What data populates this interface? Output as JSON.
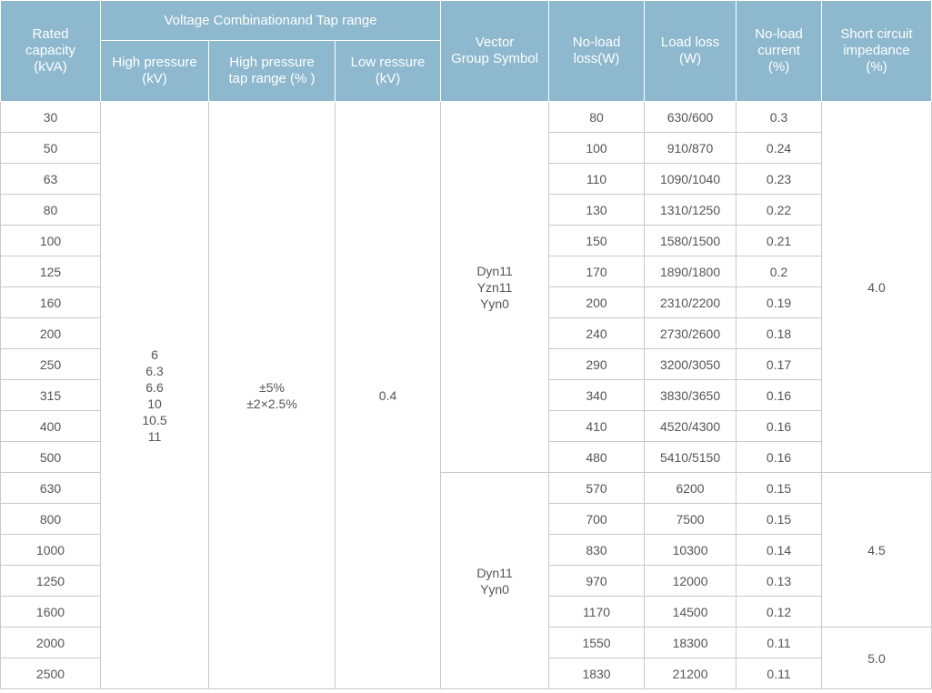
{
  "headers": {
    "rated_capacity": "Rated\ncapacity\n(kVA)",
    "voltage_group": "Voltage Combinationand Tap range",
    "high_pressure": "High pressure\n(kV)",
    "high_pressure_tap": "High pressure\ntap range (% )",
    "low_pressure": "Low ressure\n(kV)",
    "vector_group": "Vector\nGroup Symbol",
    "no_load_loss": "No-load\nloss(W)",
    "load_loss": "Load loss\n(W)",
    "no_load_current": "No-load\ncurrent\n(%)",
    "short_circuit": "Short circuit\nimpedance\n(%)"
  },
  "merged": {
    "high_pressure_values": "6\n6.3\n6.6\n10\n10.5\n11",
    "tap_range": "±5%\n±2×2.5%",
    "low_pressure_value": "0.4",
    "vector_group_a": "Dyn11\nYzn11\nYyn0",
    "vector_group_b": "Dyn11\nYyn0",
    "impedance_a": "4.0",
    "impedance_b": "4.5",
    "impedance_c": "5.0"
  },
  "rows": [
    {
      "capacity": "30",
      "no_load_loss": "80",
      "load_loss": "630/600",
      "no_load_current": "0.3"
    },
    {
      "capacity": "50",
      "no_load_loss": "100",
      "load_loss": "910/870",
      "no_load_current": "0.24"
    },
    {
      "capacity": "63",
      "no_load_loss": "110",
      "load_loss": "1090/1040",
      "no_load_current": "0.23"
    },
    {
      "capacity": "80",
      "no_load_loss": "130",
      "load_loss": "1310/1250",
      "no_load_current": "0.22"
    },
    {
      "capacity": "100",
      "no_load_loss": "150",
      "load_loss": "1580/1500",
      "no_load_current": "0.21"
    },
    {
      "capacity": "125",
      "no_load_loss": "170",
      "load_loss": "1890/1800",
      "no_load_current": "0.2"
    },
    {
      "capacity": "160",
      "no_load_loss": "200",
      "load_loss": "2310/2200",
      "no_load_current": "0.19"
    },
    {
      "capacity": "200",
      "no_load_loss": "240",
      "load_loss": "2730/2600",
      "no_load_current": "0.18"
    },
    {
      "capacity": "250",
      "no_load_loss": "290",
      "load_loss": "3200/3050",
      "no_load_current": "0.17"
    },
    {
      "capacity": "315",
      "no_load_loss": "340",
      "load_loss": "3830/3650",
      "no_load_current": "0.16"
    },
    {
      "capacity": "400",
      "no_load_loss": "410",
      "load_loss": "4520/4300",
      "no_load_current": "0.16"
    },
    {
      "capacity": "500",
      "no_load_loss": "480",
      "load_loss": "5410/5150",
      "no_load_current": "0.16"
    },
    {
      "capacity": "630",
      "no_load_loss": "570",
      "load_loss": "6200",
      "no_load_current": "0.15"
    },
    {
      "capacity": "800",
      "no_load_loss": "700",
      "load_loss": "7500",
      "no_load_current": "0.15"
    },
    {
      "capacity": "1000",
      "no_load_loss": "830",
      "load_loss": "10300",
      "no_load_current": "0.14"
    },
    {
      "capacity": "1250",
      "no_load_loss": "970",
      "load_loss": "12000",
      "no_load_current": "0.13"
    },
    {
      "capacity": "1600",
      "no_load_loss": "1170",
      "load_loss": "14500",
      "no_load_current": "0.12"
    },
    {
      "capacity": "2000",
      "no_load_loss": "1550",
      "load_loss": "18300",
      "no_load_current": "0.11"
    },
    {
      "capacity": "2500",
      "no_load_loss": "1830",
      "load_loss": "21200",
      "no_load_current": "0.11"
    }
  ],
  "colors": {
    "header_bg": "#8db8ce",
    "header_text": "#ffffff",
    "cell_text": "#555555",
    "border": "#c9c9c9"
  }
}
